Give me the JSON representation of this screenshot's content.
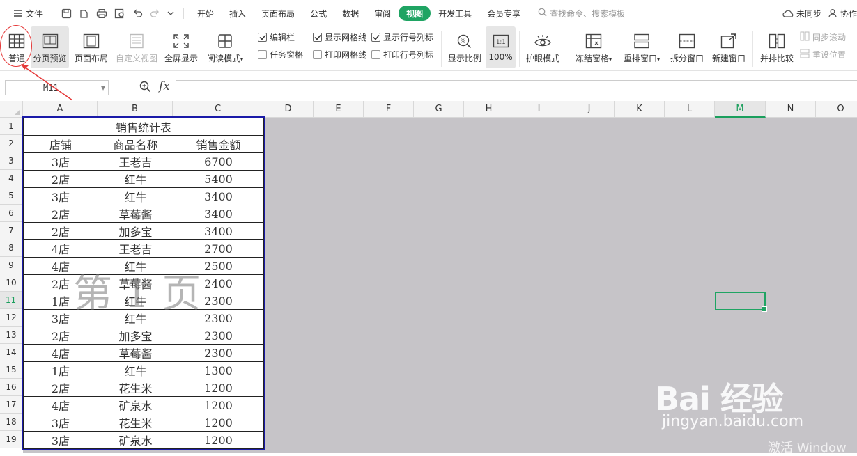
{
  "menubar": {
    "file_label": "文件",
    "tabs": [
      {
        "label": "开始"
      },
      {
        "label": "插入"
      },
      {
        "label": "页面布局"
      },
      {
        "label": "公式"
      },
      {
        "label": "数据"
      },
      {
        "label": "审阅"
      },
      {
        "label": "视图",
        "active": true
      },
      {
        "label": "开发工具"
      },
      {
        "label": "会员专享"
      }
    ],
    "search_placeholder": "查找命令、搜索模板",
    "sync_label": "未同步",
    "collab_label": "协作"
  },
  "ribbon": {
    "normal": "普通",
    "page_break_preview": "分页预览",
    "page_layout": "页面布局",
    "custom_view": "自定义视图",
    "fullscreen": "全屏显示",
    "reading_mode": "阅读模式",
    "checkboxes": {
      "edit_bar": {
        "label": "编辑栏",
        "checked": true
      },
      "show_gridlines": {
        "label": "显示网格线",
        "checked": true
      },
      "show_headings": {
        "label": "显示行号列标",
        "checked": true
      },
      "task_pane": {
        "label": "任务窗格",
        "checked": false
      },
      "print_gridlines": {
        "label": "打印网格线",
        "checked": false
      },
      "print_headings": {
        "label": "打印行号列标",
        "checked": false
      }
    },
    "zoom": "显示比例",
    "zoom_100": "100%",
    "eye_protection": "护眼模式",
    "freeze_panes": "冻结窗格",
    "rearrange_windows": "重排窗口",
    "split_window": "拆分窗口",
    "new_window": "新建窗口",
    "side_by_side": "并排比较",
    "sync_scroll": "同步滚动",
    "reset_position": "重设位置"
  },
  "formula_bar": {
    "name_box": "M11",
    "fx": "fx",
    "value": ""
  },
  "sheet": {
    "columns": [
      "A",
      "B",
      "C",
      "D",
      "E",
      "F",
      "G",
      "H",
      "I",
      "J",
      "K",
      "L",
      "M",
      "N",
      "O"
    ],
    "selected_column": "M",
    "selected_row": 11,
    "rows": [
      1,
      2,
      3,
      4,
      5,
      6,
      7,
      8,
      9,
      10,
      11,
      12,
      13,
      14,
      15,
      16,
      17,
      18,
      19
    ],
    "table_title": "销售统计表",
    "headers": [
      "店铺",
      "商品名称",
      "销售金额"
    ],
    "records": [
      [
        "3店",
        "王老吉",
        "6700"
      ],
      [
        "2店",
        "红牛",
        "5400"
      ],
      [
        "3店",
        "红牛",
        "3400"
      ],
      [
        "2店",
        "草莓酱",
        "3400"
      ],
      [
        "2店",
        "加多宝",
        "3400"
      ],
      [
        "4店",
        "王老吉",
        "2700"
      ],
      [
        "4店",
        "红牛",
        "2500"
      ],
      [
        "2店",
        "草莓酱",
        "2400"
      ],
      [
        "1店",
        "红牛",
        "2300"
      ],
      [
        "3店",
        "红牛",
        "2300"
      ],
      [
        "2店",
        "加多宝",
        "2300"
      ],
      [
        "4店",
        "草莓酱",
        "2300"
      ],
      [
        "1店",
        "红牛",
        "1300"
      ],
      [
        "2店",
        "花生米",
        "1200"
      ],
      [
        "4店",
        "矿泉水",
        "1200"
      ],
      [
        "3店",
        "花生米",
        "1200"
      ],
      [
        "3店",
        "矿泉水",
        "1200"
      ]
    ],
    "page_watermark": "第 1 页"
  },
  "overlay": {
    "baidu_logo": "Bai 经验",
    "baidu_url": "jingyan.baidu.com",
    "activate_windows": "激活 Window"
  }
}
